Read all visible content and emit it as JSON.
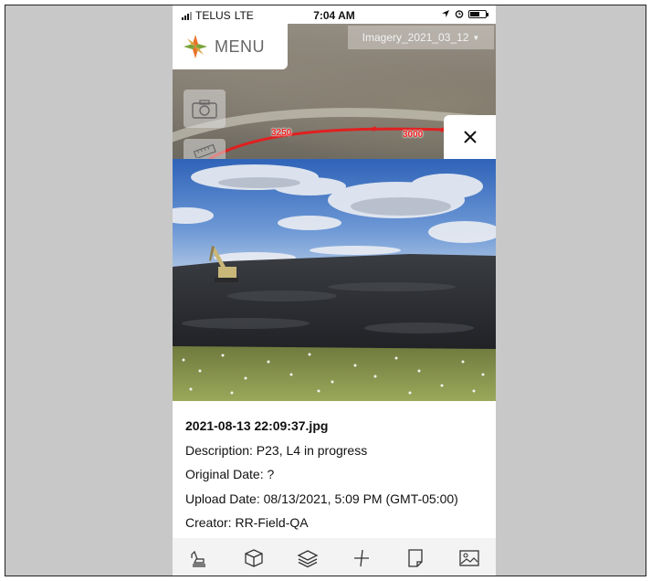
{
  "status_bar": {
    "carrier": "TELUS",
    "network": "LTE",
    "time": "7:04 AM"
  },
  "map": {
    "menu_label": "MENU",
    "imagery_select": "Imagery_2021_03_12",
    "distance_labels": [
      "3250",
      "3000"
    ],
    "route_color": "#e02020"
  },
  "photo": {
    "description": "Excavator working on dark graded earthwork slope under a cloudy blue sky, wildflowers in foreground"
  },
  "info": {
    "filename": "2021-08-13 22:09:37.jpg",
    "description": "Description: P23, L4 in progress",
    "original_date": "Original Date: ?",
    "upload_date": "Upload Date: 08/13/2021, 5:09 PM (GMT-05:00)",
    "creator": "Creator: RR-Field-QA"
  },
  "toolbar": {
    "icons": [
      "excavator-icon",
      "cube-icon",
      "layers-icon",
      "measure-icon",
      "note-icon",
      "image-icon"
    ]
  },
  "colors": {
    "accent_orange": "#e8732a",
    "accent_green": "#7aa33b",
    "panel_bg": "#f3f3f3",
    "frame_bg": "#c8c8c8"
  }
}
